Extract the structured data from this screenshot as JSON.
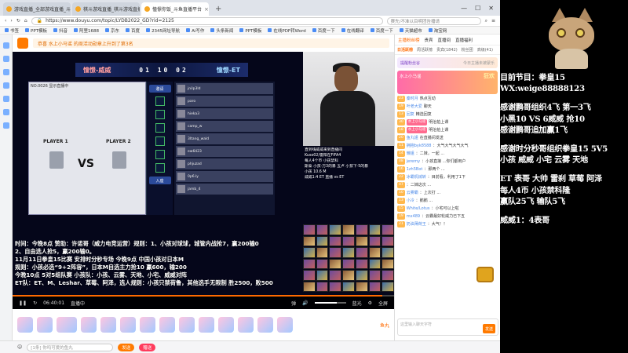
{
  "browser": {
    "tabs": [
      {
        "label": "游戏直播_全部游戏直播_斗鱼直播"
      },
      {
        "label": "棋斗游戏直播_棋斗游戏直播"
      },
      {
        "label": "憧憬你饭_斗鱼直播平台",
        "active": true
      }
    ],
    "url": "https://www.douyu.com/topic/LYDB2022_GD?rid=2125",
    "search_text": "赛先/不准以目明团告播请",
    "bookmarks": [
      "书签",
      "PPT模板",
      "抖音",
      "阿里1688",
      "京东",
      "百度",
      "2345网址导航",
      "Ai写作",
      "头条新闻",
      "PPT模板",
      "在线PDF转Word",
      "百度一下",
      "在线翻译",
      "百度一下",
      "天猫超市",
      "淘宝网"
    ]
  },
  "header": {
    "announcement": "恭喜 水上小马谣 的周活动勋章上升到了第3名"
  },
  "player": {
    "banner": {
      "left_team": "憧憬-威威",
      "score": "01 10 02",
      "right_team": "憧憬-ET"
    },
    "lobby": {
      "room_label": "NO.0026  显示直播中",
      "player1": "PLAYER 1",
      "player2": "PLAYER 2",
      "vs": "VS",
      "enter_button": "邀请",
      "seat_label": "入座"
    },
    "player_list": [
      "jnilp3ld",
      "paro",
      "hieka3",
      "camp_w",
      "3ltang_wald",
      "ew6423",
      "phjuzad",
      "0p6.ly",
      "jamb_4"
    ],
    "overlay_text": [
      "直到嗨威威来到直播间",
      "Kuso02/雷阳在FIFA4",
      "每人4个币 小孩禁科",
      "斯泰 小孩·万3的暴 五卢 小孩下·5的暴",
      "小孩 10.6 M",
      "威威1:4 ET 直播 vs ET"
    ],
    "ticker": [
      "时间：今晚8点  赞助：许诺哥（威力电竞运营）规则：1、小孩对球球，城管内战抢7，赢200输0",
      "2、自由选人抢5，赢200输0。",
      "11月11日拳皇15比赛 安排时分秒专场 今晚9点 中国小孩对日本M",
      "规则：小孩必选“9+2阵容”，日本M自选主力抢10 赢600，输200",
      "今晚10点 5对5组队赛 小孩队：小孩、云雾、天地、小宅、威威对阵",
      "ET队：ET、M、Leshar、草莓、阿泽，选人规则：小孩只禁荷鲁，其他选手无限制 胜2500，败500"
    ],
    "controls": {
      "time": "06:40:01",
      "live_label": "直播中",
      "quality": "蓝光",
      "fullscreen": "全屏"
    },
    "progress": 0.97,
    "volume": 0.7
  },
  "gifts": {
    "coin_label": "鱼丸"
  },
  "bottom": {
    "chat_placeholder": "[1条] 你吗可爱的鱼丸",
    "send_label": "发送",
    "gift_label": "赠送"
  },
  "chat": {
    "top": [
      "主播粉丝榜",
      "贵宾",
      "直播间",
      "直播福利"
    ],
    "tabs": [
      "日活跃榜",
      "周活跃榜",
      "贵宾(1842)",
      "粉丝团",
      "高级(41)"
    ],
    "strip": {
      "label": "提醒粉丝谷",
      "side": "今日主播未被蒙乐"
    },
    "promo": {
      "label": "水上小马谣",
      "big": "狂欢"
    },
    "messages": [
      {
        "lv": "23",
        "nick": "秦时月",
        "text": "热点互动"
      },
      {
        "lv": "19",
        "nick": "叶老大爱",
        "text": "聊天"
      },
      {
        "lv": "13",
        "nick": "回复",
        "text": "精选回复"
      },
      {
        "lv": "30",
        "badge": "水上小马谣",
        "nick": "",
        "text": "明治拍上课"
      },
      {
        "lv": "18",
        "badge": "水上小马谣",
        "nick": "",
        "text": "明治拍上课"
      },
      {
        "lv": "20",
        "nick": "鱼丸姐",
        "text": "在直播间发送"
      },
      {
        "lv": "11",
        "nick": "拥抱byk8588",
        "text": "：大气大气大气大气"
      },
      {
        "lv": "14",
        "nick": "懒姐",
        "text": "：二妹，一起 ..."
      },
      {
        "lv": "08",
        "nick": "jeremy",
        "text": "：小孩直接 ...你们都用户"
      },
      {
        "lv": "16",
        "nick": "1zh5Bot",
        "text": "：那两个 ..."
      },
      {
        "lv": "22",
        "nick": "冰霸机械转",
        "text": "：目前看，利用了1下"
      },
      {
        "lv": "07",
        "nick": "",
        "text": "：二妹这次 ..."
      },
      {
        "lv": "10",
        "nick": "云雾霸",
        "text": "：上次打 ..."
      },
      {
        "lv": "13",
        "nick": "小冷",
        "text": "：鹅鹅 ..."
      },
      {
        "lv": "15",
        "nick": "White/Lotus",
        "text": "：小宅可以上啦"
      },
      {
        "lv": "19",
        "nick": "mx489",
        "text": "：云霸最好轮威力已下五"
      },
      {
        "lv": "21",
        "nick": "奶油薄荷王",
        "text": "：大气！！"
      }
    ],
    "input_placeholder": "这里输入聊天字符",
    "send": "发送"
  },
  "overlay": {
    "lines": [
      "目前节目：拳皇15",
      "WX:weige88888123",
      "",
      "感谢鹏哥组织4飞 第一3飞",
      "小黑10 VS 6威威 抢10",
      "感谢鹏哥追加赢1飞",
      "",
      "感谢时分秒哥组织拳皇15 5V5",
      "小孩 威威 小宅 云雾 天地",
      "",
      "ET 表哥 大帅 雷刹 草莓 阿泽",
      "每人4币 小孩禁科隆",
      "赢队25飞 输队5飞",
      "",
      "威威1：4表哥"
    ]
  }
}
